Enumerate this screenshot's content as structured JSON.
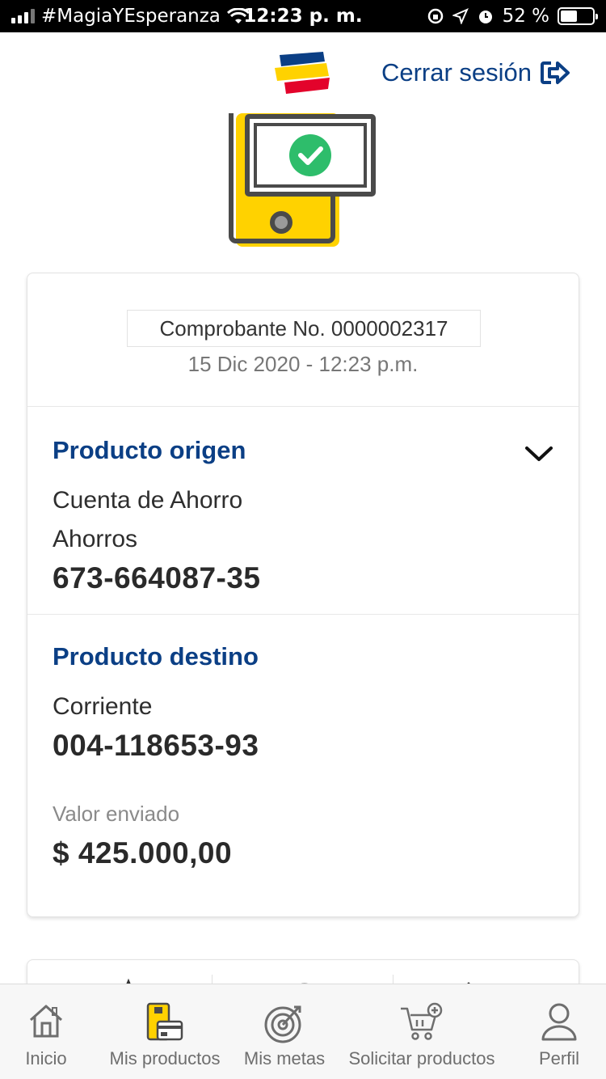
{
  "status_bar": {
    "carrier": "#MagiaYEsperanza",
    "time": "12:23 p. m.",
    "battery": "52 %",
    "battery_level": 0.52
  },
  "header": {
    "logout_label": "Cerrar sesión"
  },
  "receipt": {
    "number_label": "Comprobante No. 0000002317",
    "datetime": "15 Dic 2020 - 12:23 p.m."
  },
  "origin": {
    "title": "Producto origen",
    "product_name": "Cuenta de Ahorro",
    "product_type": "Ahorros",
    "account_number": "673-664087-35"
  },
  "destination": {
    "title": "Producto destino",
    "product_type": "Corriente",
    "account_number": "004-118653-93",
    "amount_label": "Valor enviado",
    "amount": "$ 425.000,00"
  },
  "tabbar": {
    "items": [
      {
        "label": "Inicio",
        "icon": "home-icon"
      },
      {
        "label": "Mis productos",
        "icon": "products-icon"
      },
      {
        "label": "Mis metas",
        "icon": "target-icon"
      },
      {
        "label": "Solicitar productos",
        "icon": "cart-icon"
      },
      {
        "label": "Perfil",
        "icon": "user-icon"
      }
    ],
    "active_index": 1
  },
  "colors": {
    "brand_blue": "#0b3f85",
    "brand_yellow": "#ffd200",
    "brand_red": "#e3032b",
    "success_green": "#2ebd6b"
  }
}
